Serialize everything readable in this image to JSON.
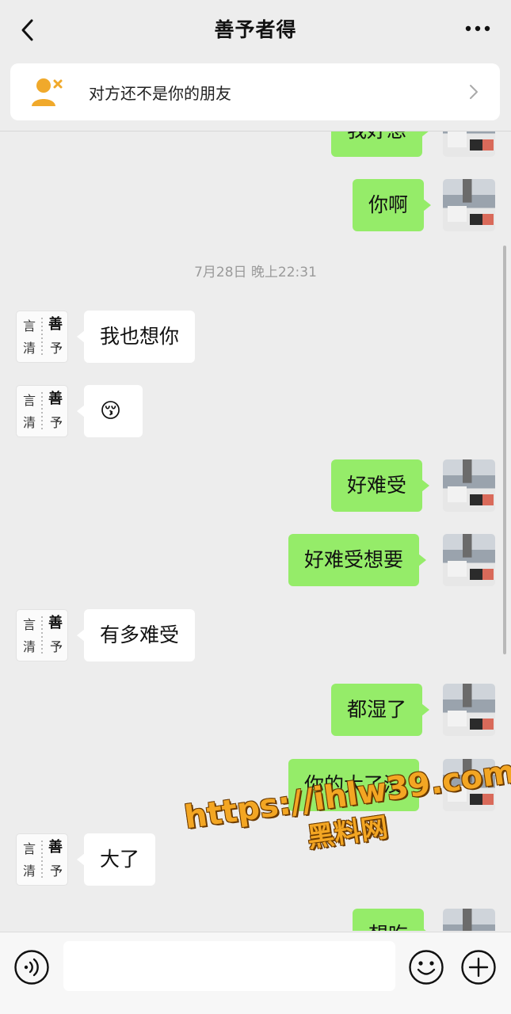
{
  "header": {
    "title": "善予者得"
  },
  "banner": {
    "text": "对方还不是你的朋友"
  },
  "messages": [
    {
      "side": "me",
      "text": "我好想"
    },
    {
      "side": "me",
      "text": "你啊"
    },
    {
      "side": "me",
      "text": "好难受"
    },
    {
      "side": "me",
      "text": "好难受想要"
    },
    {
      "side": "me",
      "text": "都湿了"
    },
    {
      "side": "me",
      "text": "你的大了没"
    },
    {
      "side": "me",
      "text": "想吃"
    },
    {
      "side": "them",
      "text": "我也想你"
    },
    {
      "side": "them",
      "text": "😚"
    },
    {
      "side": "them",
      "text": "有多难受"
    },
    {
      "side": "them",
      "text": "大了"
    }
  ],
  "timestamp": "7月28日 晚上22:31",
  "input": {
    "value": ""
  },
  "watermark": {
    "url": "https://ihlw39.com",
    "label": "黑料网"
  }
}
